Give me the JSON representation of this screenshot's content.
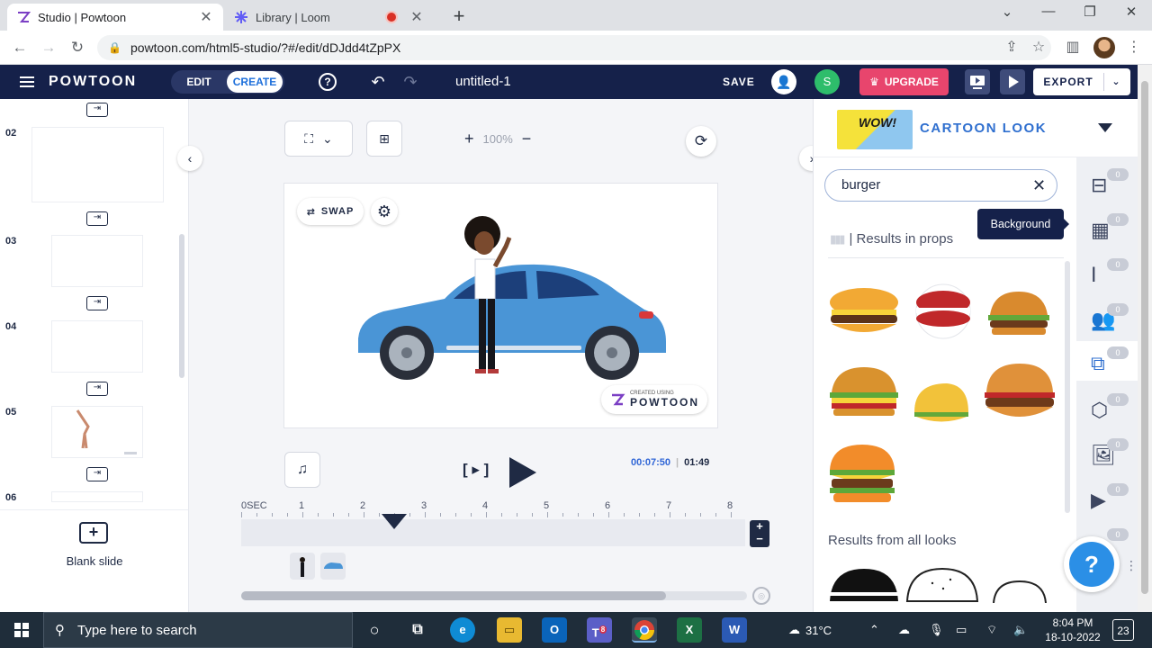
{
  "browser": {
    "tabs": [
      {
        "title": "Studio | Powtoon"
      },
      {
        "title": "Library | Loom"
      }
    ],
    "url": "powtoon.com/html5-studio/?#/edit/dDJdd4tZpPX"
  },
  "header": {
    "logo": "POWTOON",
    "mode_edit": "EDIT",
    "mode_create": "CREATE",
    "project_title": "untitled-1",
    "save": "SAVE",
    "avatar_initial": "S",
    "upgrade": "UPGRADE",
    "export": "EXPORT"
  },
  "slides": {
    "items": [
      {
        "number": "02"
      },
      {
        "number": "03"
      },
      {
        "number": "04"
      },
      {
        "number": "05"
      },
      {
        "number": "06"
      }
    ],
    "blank_slide": "Blank slide"
  },
  "stage": {
    "zoom": "100%",
    "swap_label": "SWAP",
    "watermark_small": "CREATED USING",
    "watermark_big": "POWTOON"
  },
  "timeline": {
    "current_time": "00:07:50",
    "total_time": "01:49",
    "ticks": [
      "0SEC",
      "1",
      "2",
      "3",
      "4",
      "5",
      "6",
      "7",
      "8"
    ],
    "playhead_fraction": 0.3
  },
  "library": {
    "look_title": "CARTOON LOOK",
    "thumb_text": "WOW!",
    "search_value": "burger",
    "results_props": "| Results in props",
    "results_all": "Results from all looks",
    "tooltip": "Background",
    "rail_badges": [
      "0",
      "0",
      "0",
      "0",
      "0",
      "0",
      "0",
      "0",
      "0"
    ]
  },
  "taskbar": {
    "search_placeholder": "Type here to search",
    "temperature": "31°C",
    "time": "8:04 PM",
    "date": "18-10-2022",
    "notifications": "23",
    "teams_badge": "8"
  },
  "colors": {
    "header_bg": "#15214a",
    "accent_blue": "#2f6fcf",
    "upgrade_pink": "#e8456d",
    "car_blue": "#4a95d6"
  }
}
